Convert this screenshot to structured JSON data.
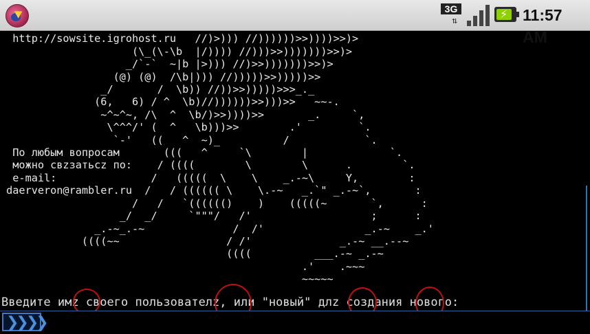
{
  "status_bar": {
    "network_type": "3G",
    "network_arrows": "⇅",
    "time": "11:57 AM",
    "battery_level": 0.85,
    "signal_bars": 4
  },
  "terminal": {
    "art_lines": [
      "                            //))))) :  )>))))>>)>",
      "  http://sowsite.igrohost.ru   //)>))) //))))))>>))))>>)>",
      "                     (\\_(\\-\\b  |/)))) //)))>>)))))))>>)>",
      "                    _/`-`  ~|b |>))) //)>>)))))))>>)>",
      "                  (@) (@)  /\\b|))) //)))))>>)))))>>",
      "                _/       /  \\b)) //))>>)))))>>>_._",
      "               (6,   6) / ^  \\b)//))))))>>)))>>   ~~-.",
      "                ~^~^~, /\\  ^  \\b/)>>))))>>       _.     `,",
      "                 \\^^^/' (  ^   \\b)))>>        .'         `.",
      "                  `-'   ((   ^  ~)_          /            `.",
      "  По любым вопросам       (((   ^     `\\        |             `.",
      "  можно свzзатьсz по:    / ((((        \\        \\      .        `.",
      "  e-mail:               /   (((((  \\    \\    _.-~\\     Y,        :",
      " daerveron@rambler.ru  /   / (((((( \\    \\.-~   _.`\" _.-~`,       :",
      "                     /   /   `(((((()    )    (((((~       `,      :",
      "                   _/  _/     `\"\"\"/   /'                   ;      :",
      "               _.-~_.-~              /  /'                _.-~    _.'",
      "             ((((~~                 / /'              _.-~ __.--~",
      "                                    ((((          ___.-~ _.-~",
      "                                                .'    .~~~",
      "                                                ~~~~~"
    ],
    "prompt": "Введите имz своего пользователz, или \"новый\" длz создания нового:"
  },
  "input": {
    "value": "",
    "button_glyph": "❯❯❯❯"
  }
}
